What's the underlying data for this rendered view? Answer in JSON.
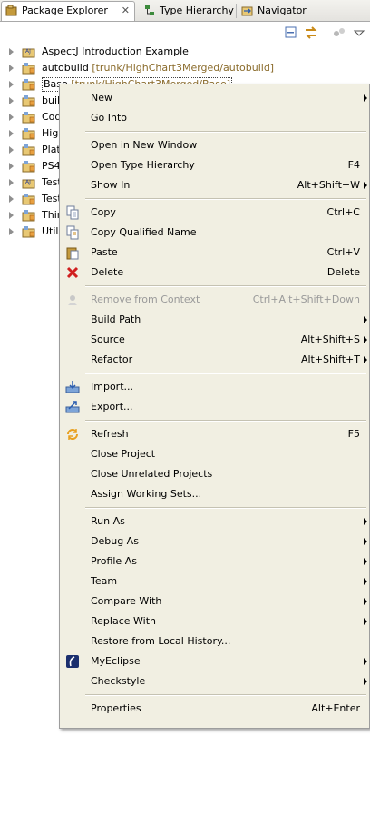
{
  "tabs": [
    {
      "label": "Package Explorer",
      "active": true,
      "icon": "package-explorer-icon",
      "close": "✕"
    },
    {
      "label": "Type Hierarchy",
      "active": false,
      "icon": "type-hierarchy-icon"
    },
    {
      "label": "Navigator",
      "active": false,
      "icon": "navigator-icon"
    }
  ],
  "toolbar": {
    "icons": [
      "collapse-all-icon",
      "link-with-editor-icon",
      "view-menu-icon"
    ]
  },
  "tree": [
    {
      "name": "AspectJ Introduction Example",
      "extra": "",
      "icon": "aspectj-project-icon"
    },
    {
      "name": "autobuild",
      "extra": "[trunk/HighChart3Merged/autobuild]",
      "icon": "svn-project-icon"
    },
    {
      "name": "Base",
      "extra": "[trunk/HighChart3Merged/Base]",
      "icon": "svn-project-icon",
      "selected": true
    },
    {
      "name": "buil",
      "extra": "",
      "icon": "svn-project-icon"
    },
    {
      "name": "Cod",
      "extra": "",
      "icon": "svn-project-icon"
    },
    {
      "name": "High",
      "extra": "",
      "icon": "svn-project-icon"
    },
    {
      "name": "Plat",
      "extra": "",
      "icon": "svn-project-icon"
    },
    {
      "name": "PS4",
      "extra": "",
      "icon": "svn-project-icon"
    },
    {
      "name": "Test",
      "extra": "",
      "icon": "aspectj-project-icon"
    },
    {
      "name": "Test",
      "extra": "",
      "icon": "svn-project-icon"
    },
    {
      "name": "Thir",
      "extra": "",
      "icon": "svn-project-icon"
    },
    {
      "name": "Util",
      "extra": "",
      "icon": "svn-project-icon"
    }
  ],
  "menu": {
    "items": [
      {
        "label": "New",
        "accel": "",
        "submenu": true
      },
      {
        "label": "Go Into",
        "accel": ""
      },
      {
        "sep": true
      },
      {
        "label": "Open in New Window",
        "accel": ""
      },
      {
        "label": "Open Type Hierarchy",
        "accel": "F4"
      },
      {
        "label": "Show In",
        "accel": "Alt+Shift+W",
        "submenu": true
      },
      {
        "sep": true
      },
      {
        "label": "Copy",
        "accel": "Ctrl+C",
        "icon": "copy-icon"
      },
      {
        "label": "Copy Qualified Name",
        "accel": "",
        "icon": "copy-qualified-name-icon"
      },
      {
        "label": "Paste",
        "accel": "Ctrl+V",
        "icon": "paste-icon"
      },
      {
        "label": "Delete",
        "accel": "Delete",
        "icon": "delete-icon"
      },
      {
        "sep": true
      },
      {
        "label": "Remove from Context",
        "accel": "Ctrl+Alt+Shift+Down",
        "disabled": true,
        "icon": "remove-context-icon"
      },
      {
        "label": "Build Path",
        "accel": "",
        "submenu": true
      },
      {
        "label": "Source",
        "accel": "Alt+Shift+S",
        "submenu": true
      },
      {
        "label": "Refactor",
        "accel": "Alt+Shift+T",
        "submenu": true
      },
      {
        "sep": true
      },
      {
        "label": "Import...",
        "accel": "",
        "icon": "import-icon"
      },
      {
        "label": "Export...",
        "accel": "",
        "icon": "export-icon"
      },
      {
        "sep": true
      },
      {
        "label": "Refresh",
        "accel": "F5",
        "icon": "refresh-icon"
      },
      {
        "label": "Close Project",
        "accel": ""
      },
      {
        "label": "Close Unrelated Projects",
        "accel": ""
      },
      {
        "label": "Assign Working Sets...",
        "accel": ""
      },
      {
        "sep": true
      },
      {
        "label": "Run As",
        "accel": "",
        "submenu": true
      },
      {
        "label": "Debug As",
        "accel": "",
        "submenu": true
      },
      {
        "label": "Profile As",
        "accel": "",
        "submenu": true
      },
      {
        "label": "Team",
        "accel": "",
        "submenu": true
      },
      {
        "label": "Compare With",
        "accel": "",
        "submenu": true
      },
      {
        "label": "Replace With",
        "accel": "",
        "submenu": true
      },
      {
        "label": "Restore from Local History...",
        "accel": ""
      },
      {
        "label": "MyEclipse",
        "accel": "",
        "submenu": true,
        "icon": "myeclipse-icon"
      },
      {
        "label": "Checkstyle",
        "accel": "",
        "submenu": true
      },
      {
        "sep": true
      },
      {
        "label": "Properties",
        "accel": "Alt+Enter"
      }
    ]
  },
  "colors": {
    "menu_bg": "#f1efe2",
    "svn_path": "#8a6b2b",
    "selection_border": "#444444"
  }
}
